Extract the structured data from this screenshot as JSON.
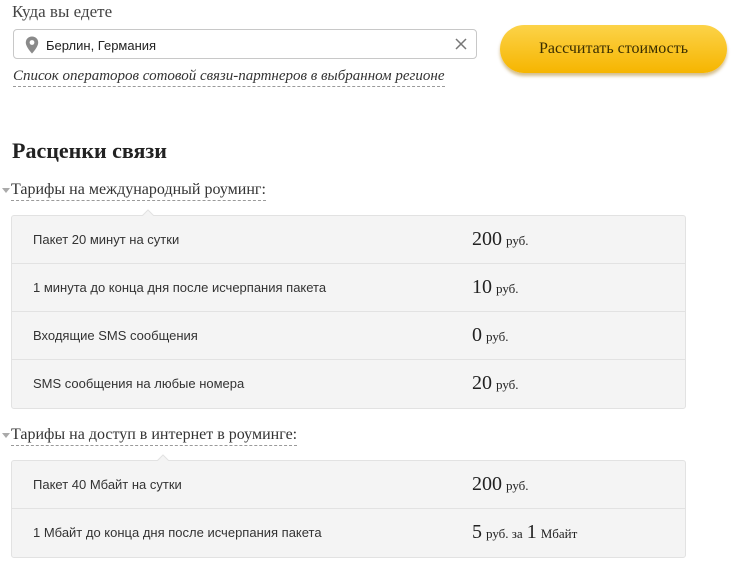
{
  "destination": {
    "label": "Куда вы едете",
    "value": "Берлин, Германия",
    "clear_icon": "close-icon",
    "pin_icon": "location-pin-icon"
  },
  "calculate_button": {
    "label": "Рассчитать стоимость"
  },
  "partners_link": {
    "label": "Список операторов сотовой связи-партнеров в выбранном регионе"
  },
  "rates": {
    "title": "Расценки связи",
    "groups": [
      {
        "title": "Тарифы на международный роуминг:",
        "rows": [
          {
            "name": "Пакет 20 минут на сутки",
            "amount": "200",
            "unit": "руб."
          },
          {
            "name": "1 минута до конца дня после исчерпания пакета",
            "amount": "10",
            "unit": "руб."
          },
          {
            "name": "Входящие SMS сообщения",
            "amount": "0",
            "unit": "руб."
          },
          {
            "name": "SMS сообщения на любые номера",
            "amount": "20",
            "unit": "руб."
          }
        ]
      },
      {
        "title": "Тарифы на доступ в интернет в роуминге:",
        "rows": [
          {
            "name": "Пакет 40 Мбайт на сутки",
            "amount": "200",
            "unit": "руб."
          },
          {
            "name": "1 Мбайт до конца дня после исчерпания пакета",
            "amount": "5",
            "unit": "руб. за",
            "amount2": "1",
            "unit2": "Мбайт"
          }
        ]
      }
    ]
  },
  "colors": {
    "button_top": "#fcd349",
    "button_bottom": "#f6b500",
    "table_bg": "#f4f4f4",
    "border": "#e2e2e2"
  }
}
